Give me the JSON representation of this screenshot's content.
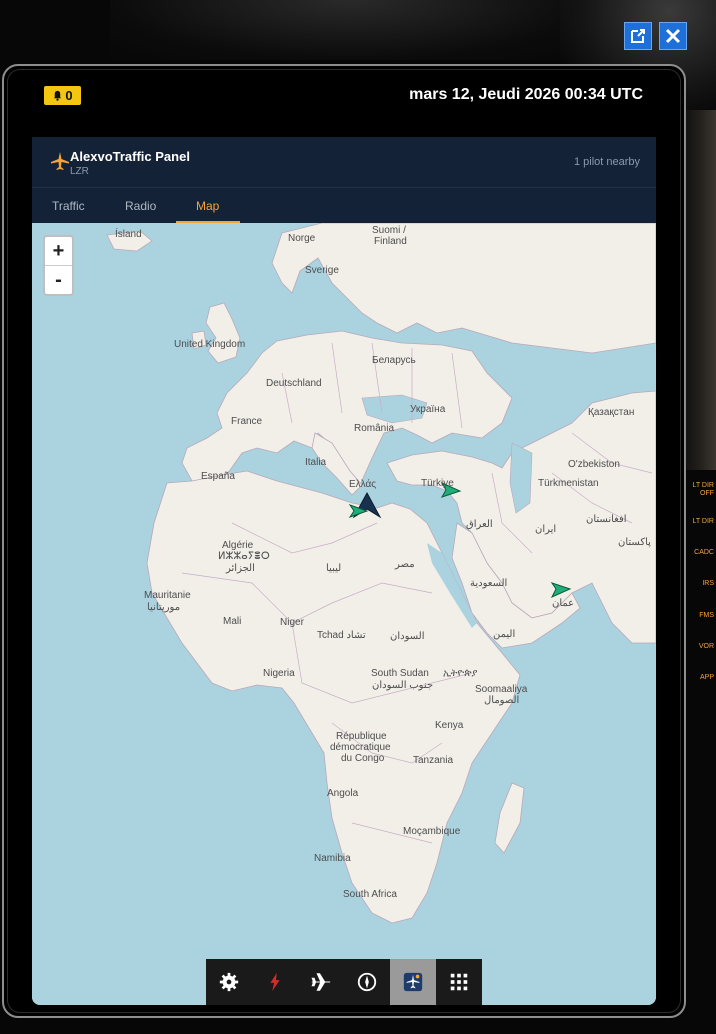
{
  "window": {
    "popout_icon": "external-link-icon",
    "close_icon": "close-icon"
  },
  "tablet": {
    "notification_count": "0",
    "datetime": "mars 12, Jeudi 2026 00:34 UTC"
  },
  "panel": {
    "title": "AlexvoTraffic Panel",
    "subtitle": "LZR",
    "pilots_nearby": "1 pilot nearby",
    "tabs": [
      {
        "label": "Traffic"
      },
      {
        "label": "Radio"
      },
      {
        "label": "Map"
      }
    ],
    "active_tab": "Map"
  },
  "map": {
    "zoom_in": "+",
    "zoom_out": "-",
    "labels": {
      "island": "Ísland",
      "norge": "Norge",
      "suomi": "Suomi /",
      "finland": "Finland",
      "sverige": "Sverige",
      "uk": "United Kingdom",
      "belarus": "Беларусь",
      "deutschland": "Deutschland",
      "ukraina": "Україна",
      "kazakhstan": "Қазақстан",
      "france": "France",
      "romania": "România",
      "italia": "Italia",
      "espana": "España",
      "ellas": "Ελλάς",
      "turkiye": "Türkiye",
      "uzbekiston": "O'zbekiston",
      "turkmenistan": "Türkmenistan",
      "algerie": "Algérie",
      "algerie_tif": "ⵍⵣⵣⴰⵢⴻⵔ",
      "algerie_ar": "الجزائر",
      "libya": "ليبيا",
      "misr": "مصر",
      "iraq": "العراق",
      "iran": "ایران",
      "afghanistan": "افغانستان",
      "pakistan": "پاکستان",
      "saudi": "السعودية",
      "oman": "عمان",
      "mauritanie": "Mauritanie",
      "mauritanie_ar": "موريتانيا",
      "mali": "Mali",
      "niger": "Niger",
      "tchad": "Tchad تشاد",
      "sudan": "السودان",
      "yemen": "اليمن",
      "nigeria": "Nigeria",
      "south_sudan": "South Sudan",
      "south_sudan_ar": "جنوب السودان",
      "ethiopia": "ኢትዮጵያ",
      "somalia": "Soomaaliya",
      "somalia_ar": "الصومال",
      "kenya": "Kenya",
      "rdc1": "République",
      "rdc2": "démocratique",
      "rdc3": "du Congo",
      "tanzania": "Tanzania",
      "angola": "Angola",
      "mocambique": "Moçambique",
      "namibia": "Namibia",
      "south_africa": "South Africa"
    }
  },
  "toolbar": {
    "items": [
      {
        "icon": "gear-icon"
      },
      {
        "icon": "lightning-icon"
      },
      {
        "icon": "airplane-icon"
      },
      {
        "icon": "compass-icon"
      },
      {
        "icon": "traffic-panel-icon"
      },
      {
        "icon": "apps-grid-icon"
      }
    ],
    "active_item": "traffic-panel-icon"
  },
  "cockpit_labels": {
    "l1": "LT DIR",
    "l1b": "OFF",
    "l2": "LT DIR",
    "l3": "CADC",
    "l4": "IRS",
    "l5": "FMS",
    "l6": "VOR",
    "l7": "APP"
  },
  "colors": {
    "header_bg": "#142237",
    "active_tab": "#f4a53a",
    "water": "#aad3df",
    "land": "#f2efe9",
    "notif_badge": "#f3c612",
    "own_aircraft": "#17324f",
    "traffic_aircraft": "#1fae7a"
  }
}
